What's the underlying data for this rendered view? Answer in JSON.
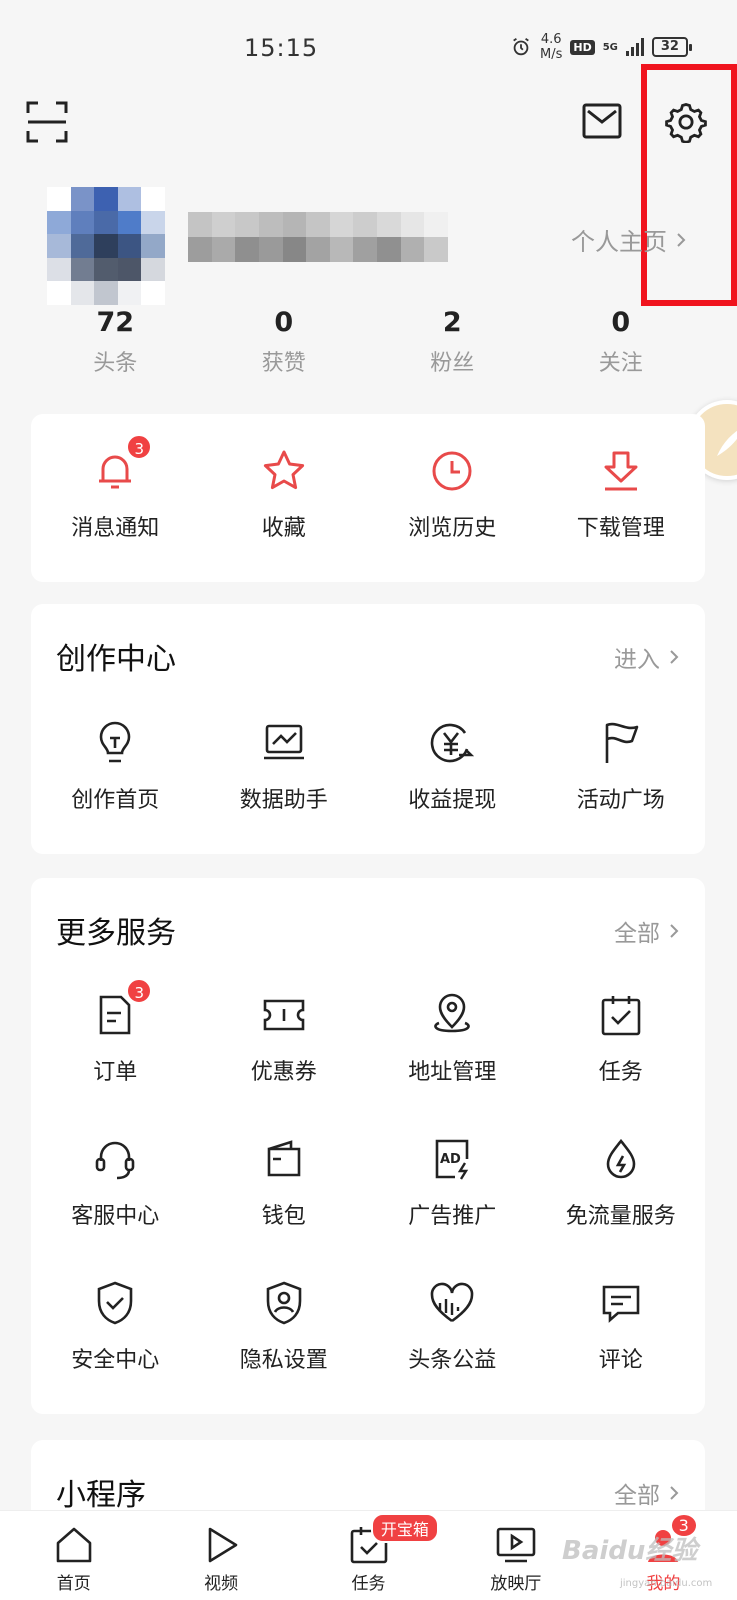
{
  "status_bar": {
    "time": "15:15",
    "speed_value": "4.6",
    "speed_unit": "M/s",
    "hd": "HD",
    "net_top": "5G",
    "battery": "32",
    "alarm_icon": "alarm-clock-icon"
  },
  "header": {
    "scan_icon": "scan-icon",
    "mail_icon": "mail-icon",
    "settings_icon": "gear-icon"
  },
  "profile": {
    "homepage_link": "个人主页"
  },
  "stats": [
    {
      "value": "72",
      "label": "头条"
    },
    {
      "value": "0",
      "label": "获赞"
    },
    {
      "value": "2",
      "label": "粉丝"
    },
    {
      "value": "0",
      "label": "关注"
    }
  ],
  "quick_actions": [
    {
      "label": "消息通知",
      "icon": "bell-icon",
      "badge": "3"
    },
    {
      "label": "收藏",
      "icon": "star-icon"
    },
    {
      "label": "浏览历史",
      "icon": "clock-icon"
    },
    {
      "label": "下载管理",
      "icon": "download-icon"
    }
  ],
  "creation": {
    "title": "创作中心",
    "link": "进入",
    "items": [
      {
        "label": "创作首页",
        "icon": "lightbulb-icon"
      },
      {
        "label": "数据助手",
        "icon": "chart-monitor-icon"
      },
      {
        "label": "收益提现",
        "icon": "yen-transfer-icon"
      },
      {
        "label": "活动广场",
        "icon": "flag-icon"
      }
    ]
  },
  "services": {
    "title": "更多服务",
    "link": "全部",
    "rows": [
      [
        {
          "label": "订单",
          "icon": "order-icon",
          "badge": "3"
        },
        {
          "label": "优惠券",
          "icon": "coupon-icon"
        },
        {
          "label": "地址管理",
          "icon": "location-pin-icon"
        },
        {
          "label": "任务",
          "icon": "calendar-check-icon"
        }
      ],
      [
        {
          "label": "客服中心",
          "icon": "headset-icon"
        },
        {
          "label": "钱包",
          "icon": "wallet-icon"
        },
        {
          "label": "广告推广",
          "icon": "ad-icon"
        },
        {
          "label": "免流量服务",
          "icon": "drop-bolt-icon"
        }
      ],
      [
        {
          "label": "安全中心",
          "icon": "shield-check-icon"
        },
        {
          "label": "隐私设置",
          "icon": "shield-user-icon"
        },
        {
          "label": "头条公益",
          "icon": "charity-heart-icon"
        },
        {
          "label": "评论",
          "icon": "comment-icon"
        }
      ]
    ]
  },
  "mini_programs": {
    "title": "小程序",
    "link": "全部"
  },
  "tabbar": [
    {
      "label": "首页",
      "icon": "home-icon"
    },
    {
      "label": "视频",
      "icon": "play-icon"
    },
    {
      "label": "任务",
      "icon": "task-icon",
      "badge": "开宝箱"
    },
    {
      "label": "放映厅",
      "icon": "screen-play-icon"
    },
    {
      "label": "我的",
      "icon": "profile-icon",
      "badge": "3",
      "active": true
    }
  ],
  "watermark": "Baidu经验",
  "watermark_sub": "jingyan.baidu.com",
  "colors": {
    "accent": "#f04142",
    "highlight": "#f0141e",
    "background": "#f6f6f6"
  }
}
